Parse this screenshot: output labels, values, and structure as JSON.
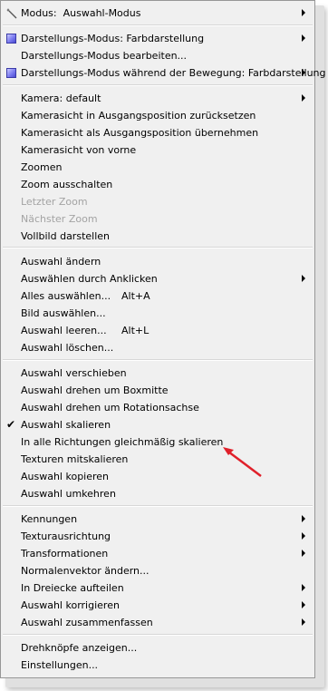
{
  "menu": {
    "items": [
      {
        "label": "Modus:  Auswahl-Modus",
        "icon": "wand-icon",
        "submenu": true
      },
      {
        "label": "Darstellungs-Modus: Farbdarstellung",
        "icon": "cube-icon",
        "submenu": true
      },
      {
        "label": "Darstellungs-Modus bearbeiten..."
      },
      {
        "label": "Darstellungs-Modus während der Bewegung: Farbdarstellung",
        "icon": "cube-icon",
        "submenu": true
      },
      {
        "label": "Kamera: default",
        "submenu": true
      },
      {
        "label": "Kamerasicht in Ausgangsposition zurücksetzen"
      },
      {
        "label": "Kamerasicht als Ausgangsposition übernehmen"
      },
      {
        "label": "Kamerasicht von vorne"
      },
      {
        "label": "Zoomen"
      },
      {
        "label": "Zoom ausschalten"
      },
      {
        "label": "Letzter Zoom",
        "disabled": true
      },
      {
        "label": "Nächster Zoom",
        "disabled": true
      },
      {
        "label": "Vollbild darstellen"
      },
      {
        "label": "Auswahl ändern"
      },
      {
        "label": "Auswählen durch Anklicken",
        "submenu": true
      },
      {
        "label": "Alles auswählen...",
        "shortcut": "Alt+A"
      },
      {
        "label": "Bild auswählen..."
      },
      {
        "label": "Auswahl leeren...",
        "shortcut": "Alt+L"
      },
      {
        "label": "Auswahl löschen..."
      },
      {
        "label": "Auswahl verschieben"
      },
      {
        "label": "Auswahl drehen um Boxmitte"
      },
      {
        "label": "Auswahl drehen um Rotationsachse"
      },
      {
        "label": "Auswahl skalieren",
        "checked": true
      },
      {
        "label": "In alle Richtungen gleichmäßig skalieren"
      },
      {
        "label": "Texturen mitskalieren"
      },
      {
        "label": "Auswahl kopieren"
      },
      {
        "label": "Auswahl umkehren"
      },
      {
        "label": "Kennungen",
        "submenu": true
      },
      {
        "label": "Texturausrichtung",
        "submenu": true
      },
      {
        "label": "Transformationen",
        "submenu": true
      },
      {
        "label": "Normalenvektor ändern..."
      },
      {
        "label": "In Dreiecke aufteilen",
        "submenu": true
      },
      {
        "label": "Auswahl korrigieren",
        "submenu": true
      },
      {
        "label": "Auswahl zusammenfassen",
        "submenu": true
      },
      {
        "label": "Drehknöpfe anzeigen..."
      },
      {
        "label": "Einstellungen..."
      }
    ]
  },
  "colors": {
    "menu_bg": "#f0f0f0",
    "disabled_text": "#a3a3a3",
    "annotation_arrow": "#e0202a"
  }
}
